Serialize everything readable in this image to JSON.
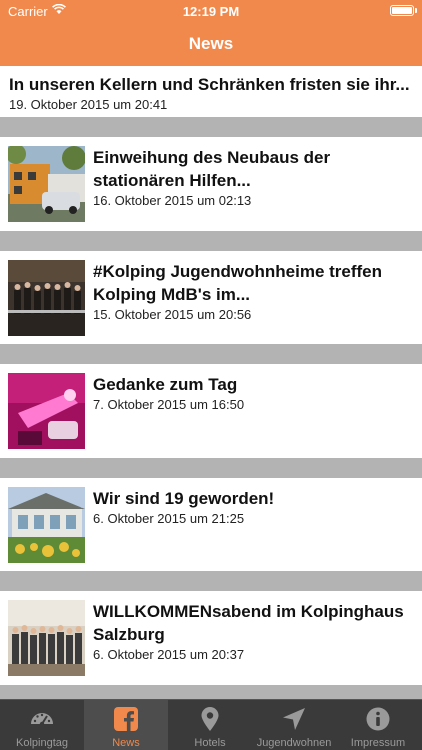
{
  "status_bar": {
    "carrier": "Carrier",
    "time": "12:19 PM"
  },
  "nav": {
    "title": "News"
  },
  "news": [
    {
      "title": "In unseren Kellern und Schränken fristen sie ihr...",
      "date": "19. Oktober 2015 um 20:41",
      "image": "none"
    },
    {
      "title": "Einweihung des Neubaus der stationären Hilfen...",
      "date": "16. Oktober 2015 um 02:13",
      "image": "building-photo"
    },
    {
      "title": "#Kolping Jugendwohnheime treffen Kolping MdB's im...",
      "date": "15. Oktober 2015 um 20:56",
      "image": "group-photo"
    },
    {
      "title": "Gedanke zum Tag",
      "date": "7. Oktober 2015 um 16:50",
      "image": "pink-light-photo"
    },
    {
      "title": "Wir sind 19 geworden!",
      "date": "6. Oktober 2015 um 21:25",
      "image": "house-garden-photo"
    },
    {
      "title": "WILLKOMMENsabend im Kolpinghaus Salzburg",
      "date": "6. Oktober 2015 um 20:37",
      "image": "group-photo-2"
    }
  ],
  "tabs": [
    {
      "label": "Kolpingtag",
      "icon": "dashboard-icon",
      "active": false
    },
    {
      "label": "News",
      "icon": "facebook-icon",
      "active": true
    },
    {
      "label": "Hotels",
      "icon": "map-pin-icon",
      "active": false
    },
    {
      "label": "Jugendwohnen",
      "icon": "navigation-arrow-icon",
      "active": false
    },
    {
      "label": "Impressum",
      "icon": "info-icon",
      "active": false
    }
  ],
  "colors": {
    "accent": "#f0894b",
    "separator": "#b3b3b3",
    "tabbar": "#3a3a3a"
  }
}
